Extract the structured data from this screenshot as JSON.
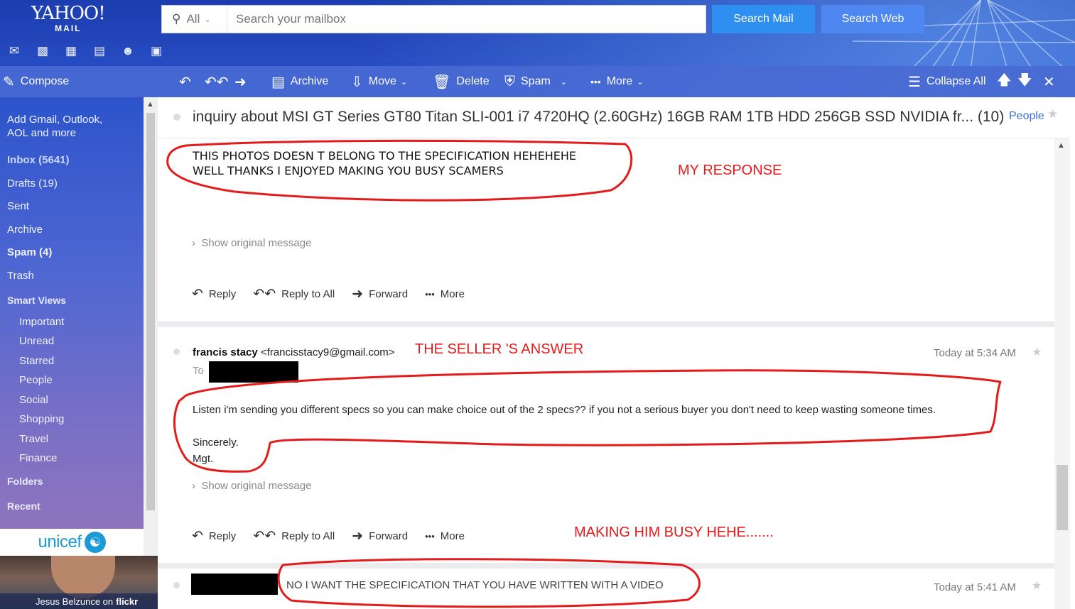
{
  "header": {
    "logo_main": "YAHOO!",
    "logo_sub": "MAIL",
    "search_scope": "All",
    "search_placeholder": "Search your mailbox",
    "search_mail_label": "Search Mail",
    "search_web_label": "Search Web"
  },
  "app_icons": [
    "mail-icon",
    "contacts-icon",
    "calendar-icon",
    "notepad-icon",
    "messenger-icon",
    "news-icon"
  ],
  "toolbar": {
    "compose": "Compose",
    "archive": "Archive",
    "move": "Move",
    "delete": "Delete",
    "spam": "Spam",
    "more": "More",
    "collapse_all": "Collapse All"
  },
  "sidebar": {
    "add_accounts_line1": "Add Gmail, Outlook,",
    "add_accounts_line2": "AOL and more",
    "inbox": "Inbox (5641)",
    "drafts": "Drafts (19)",
    "sent": "Sent",
    "archive": "Archive",
    "spam": "Spam (4)",
    "trash": "Trash",
    "smart_views": "Smart Views",
    "smart_items": [
      "Important",
      "Unread",
      "Starred",
      "People",
      "Social",
      "Shopping",
      "Travel",
      "Finance"
    ],
    "folders": "Folders",
    "recent": "Recent"
  },
  "ad": {
    "brand": "unicef",
    "credit_name": "Jesus Belzunce on",
    "credit_site": "flickr"
  },
  "thread": {
    "subject": "inquiry about MSI GT Series GT80 Titan SLI-001 i7 4720HQ (2.60GHz) 16GB RAM 1TB HDD 256GB SSD NVIDIA fr... (10)",
    "people_link": "People"
  },
  "messages": [
    {
      "line1": "THIS PHOTOS DOESN T BELONG TO THE SPECIFICATION HEHEHEHE",
      "line2": "WELL THANKS  I ENJOYED MAKING YOU BUSY SCAMERS",
      "show_original": "Show original message"
    },
    {
      "sender_name": "francis stacy",
      "sender_email": "<francisstacy9@gmail.com>",
      "to_label": "To",
      "time": "Today at 5:34 AM",
      "body_line1": "Listen i'm sending you different specs so you can make choice out of the 2 specs?? if you not a serious buyer you don't need to keep wasting someone times.",
      "body_line2": "Sincerely.",
      "body_line3": "Mgt.",
      "show_original": "Show original message"
    },
    {
      "snippet": "NO I WANT THE SPECIFICATION THAT YOU HAVE WRITTEN WITH A VIDEO",
      "time": "Today at 5:41 AM"
    }
  ],
  "actions": {
    "reply": "Reply",
    "reply_all": "Reply to All",
    "forward": "Forward",
    "more": "More"
  },
  "annotations": {
    "my_response": "MY RESPONSE",
    "seller_answer": "THE SELLER 'S ANSWER",
    "making_busy": "MAKING HIM BUSY HEHE......."
  },
  "colors": {
    "accent": "#2f8ff0",
    "annotation_red": "#e41b1b",
    "toolbar_bg": "#4869d2"
  }
}
